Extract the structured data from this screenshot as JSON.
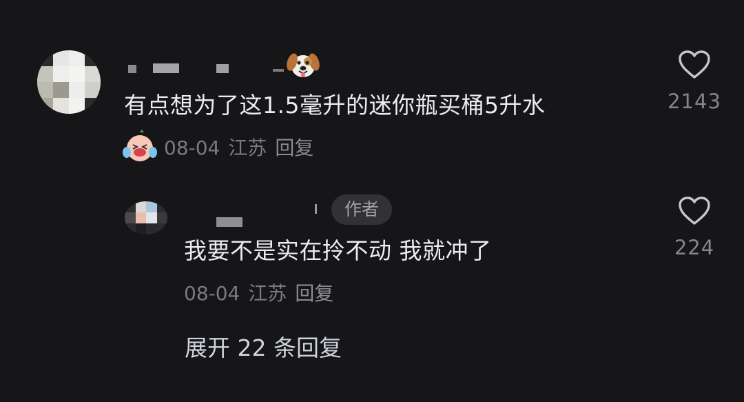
{
  "comment": {
    "username_emoji": "dog-face-emoji",
    "text": "有点想为了这1.5毫升的迷你瓶买桶5升水",
    "reaction_emoji": "laughing-crying-emoji",
    "date": "08-04",
    "location": "江苏",
    "reply_label": "回复",
    "like_count": "2143"
  },
  "reply": {
    "badge": "作者",
    "text": "我要不是实在拎不动 我就冲了",
    "date": "08-04",
    "location": "江苏",
    "reply_label": "回复",
    "like_count": "224"
  },
  "expand_label": "展开 22 条回复",
  "colors": {
    "background": "#161619",
    "text_primary": "#ececee",
    "text_secondary": "#7b7b7f",
    "badge_bg": "#323235"
  }
}
